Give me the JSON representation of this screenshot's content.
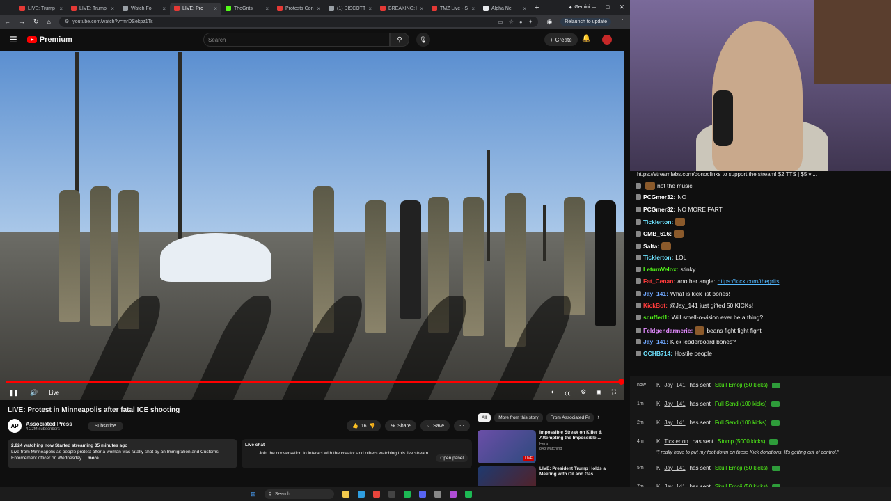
{
  "browser": {
    "tabs": [
      {
        "title": "LIVE: Trump",
        "color": "#e53935"
      },
      {
        "title": "LIVE: Trump a",
        "color": "#e53935"
      },
      {
        "title": "Watch Fo",
        "color": "#9aa0a6"
      },
      {
        "title": "LIVE: Pro",
        "color": "#e53935"
      },
      {
        "title": "TheGrits",
        "color": "#53fc18"
      },
      {
        "title": "Protests Con",
        "color": "#e53935"
      },
      {
        "title": "(1) DISCOTT",
        "color": "#9aa0a6"
      },
      {
        "title": "BREAKING: L",
        "color": "#e53935"
      },
      {
        "title": "TMZ Live - St",
        "color": "#e53935"
      },
      {
        "title": "Alpha Ne",
        "color": "#e8eaed"
      }
    ],
    "gemini_label": "Gemini",
    "url": "youtube.com/watch?v=mrDSekpz1Ts",
    "relaunch": "Relaunch to update"
  },
  "youtube": {
    "logo": "Premium",
    "search_placeholder": "Search",
    "create": "Create",
    "video": {
      "progress": 0.995,
      "live_label": "Live"
    },
    "title": "LIVE: Protest in Minneapolis after fatal ICE shooting",
    "channel": {
      "avatar": "AP",
      "name": "Associated Press",
      "subscribers": "4.22M subscribers",
      "subscribe": "Subscribe"
    },
    "actions": {
      "likes": "16",
      "share": "Share",
      "save": "Save"
    },
    "description": {
      "stats": "2,824 watching now  Started streaming 35 minutes ago",
      "text": "Live from Minneapolis as people protest after a woman was fatally shot by an Immigration and Customs Enforcement officer on Wednesday.",
      "more": "...more"
    },
    "live_chat": {
      "label": "Live chat",
      "message": "Join the conversation to interact with the creator and others watching this live stream.",
      "open_panel": "Open panel"
    },
    "chips": [
      "All",
      "More from this story",
      "From Associated Pr"
    ],
    "recommendations": [
      {
        "title": "Impossible Streak on Killer & Attempting the Impossible ...",
        "channel": "Hera",
        "meta": "848 watching",
        "badge": "LIVE"
      },
      {
        "title": "LIVE: President Trump Holds a Meeting with Oil and Gas ...",
        "channel": "",
        "meta": "",
        "badge": ""
      }
    ]
  },
  "stream": {
    "banner_link": "https://streamlabs.com/donoclinks",
    "banner_text": " to support the stream! $2 TTS | $5 vi..."
  },
  "chat": [
    {
      "user": "",
      "color": "#ff7a7a",
      "text": "not the music",
      "emote": true
    },
    {
      "user": "PCGmer32:",
      "color": "#ffffff",
      "text": "NO",
      "emote": false
    },
    {
      "user": "PCGmer32:",
      "color": "#ffffff",
      "text": "NO MORE FART",
      "emote": false
    },
    {
      "user": "Ticklerton:",
      "color": "#6fe3ff",
      "text": "",
      "emote": true
    },
    {
      "user": "CMB_616:",
      "color": "#ffffff",
      "text": "",
      "emote": true
    },
    {
      "user": "Salta:",
      "color": "#ffffff",
      "text": "",
      "emote": true
    },
    {
      "user": "Ticklerton:",
      "color": "#6fe3ff",
      "text": "LOL",
      "emote": false
    },
    {
      "user": "LetumVelox:",
      "color": "#53fc18",
      "text": "stinky",
      "emote": false
    },
    {
      "user": "Fat_Cenan:",
      "color": "#ff3b3b",
      "text": "another angle: ",
      "link": "https://kick.com/thegrits",
      "emote": false
    },
    {
      "user": "Jay_141:",
      "color": "#6fa8ff",
      "text": "What is kick list bones!",
      "emote": false
    },
    {
      "user": "KickBot:",
      "color": "#ff3b3b",
      "text": "@Jay_141 just gifted 50 KICKs!",
      "emote": false
    },
    {
      "user": "scuffed1:",
      "color": "#53fc18",
      "text": "Will smell-o-vision ever be a thing?",
      "emote": false
    },
    {
      "user": "Feldgendarmerie:",
      "color": "#e38bff",
      "text": "beans fight fight fight",
      "emote": true
    },
    {
      "user": "Jay_141:",
      "color": "#6fa8ff",
      "text": "Kick leaderboard bones?",
      "emote": false
    },
    {
      "user": "OCHB714:",
      "color": "#6fe3ff",
      "text": "Hostile people",
      "emote": false
    }
  ],
  "gifts": [
    {
      "time": "now",
      "user": "Jay_141",
      "verb": "has sent",
      "item": "Skull Emoji (50 kicks)"
    },
    {
      "time": "1m",
      "user": "Jay_141",
      "verb": "has sent",
      "item": "Full Send (100 kicks)"
    },
    {
      "time": "2m",
      "user": "Jay_141",
      "verb": "has sent",
      "item": "Full Send (100 kicks)"
    },
    {
      "time": "4m",
      "user": "Ticklerton",
      "verb": "has sent",
      "item": "Stomp (5000 kicks)"
    },
    {
      "time": "5m",
      "user": "Jay_141",
      "verb": "has sent",
      "item": "Skull Emoji (50 kicks)"
    },
    {
      "time": "7m",
      "user": "Jay_141",
      "verb": "has sent",
      "item": "Skull Emoji (50 kicks)"
    }
  ],
  "gift_quote": "\"I really have to put my foot down on these Kick donations. It's getting out of control.\"",
  "taskbar": {
    "search": "Search"
  }
}
